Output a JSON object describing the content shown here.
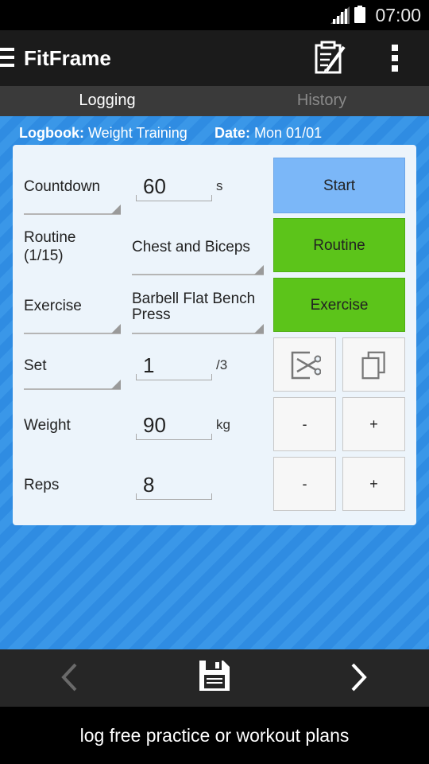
{
  "status_bar": {
    "time": "07:00"
  },
  "action_bar": {
    "title": "FitFrame"
  },
  "tabs": [
    {
      "label": "Logging",
      "active": true
    },
    {
      "label": "History",
      "active": false
    }
  ],
  "header": {
    "logbook_label": "Logbook:",
    "logbook_value": "Weight Training",
    "date_label": "Date:",
    "date_value": "Mon 01/01"
  },
  "form": {
    "countdown": {
      "label": "Countdown",
      "value": "60",
      "unit": "s"
    },
    "routine": {
      "label_line1": "Routine",
      "label_line2": "(1/15)",
      "value": "Chest and Biceps"
    },
    "exercise": {
      "label": "Exercise",
      "value_line1": "Barbell Flat Bench",
      "value_line2": "Press"
    },
    "set": {
      "label": "Set",
      "value": "1",
      "unit": "/3"
    },
    "weight": {
      "label": "Weight",
      "value": "90",
      "unit": "kg"
    },
    "reps": {
      "label": "Reps",
      "value": "8"
    }
  },
  "buttons": {
    "start": "Start",
    "routine": "Routine",
    "exercise": "Exercise",
    "weight_minus": "-",
    "weight_plus": "+",
    "reps_minus": "-",
    "reps_plus": "+"
  },
  "caption": "log free practice or workout plans",
  "colors": {
    "start_button": "#7bb7f8",
    "green_button": "#5cc41a",
    "background_stripe_a": "#3a97e8",
    "background_stripe_b": "#2f8ce2",
    "card": "#ecf4fb"
  },
  "icons": [
    "signal-icon",
    "battery-icon",
    "menu-icon",
    "clipboard-icon",
    "overflow-icon",
    "cut-icon",
    "copy-icon",
    "prev-icon",
    "save-icon",
    "next-icon"
  ]
}
